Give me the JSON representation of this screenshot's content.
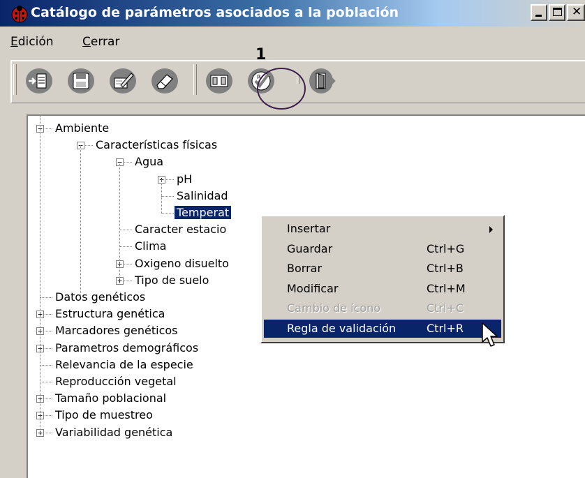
{
  "window": {
    "title": "Catálogo de parámetros asociados a la población",
    "controls": [
      "minimize",
      "maximize",
      "close"
    ]
  },
  "menubar": {
    "items": [
      {
        "accel": "E",
        "rest": "dición"
      },
      {
        "accel": "C",
        "rest": "errar"
      }
    ]
  },
  "toolbar": {
    "buttons": [
      "insert-icon",
      "save-icon",
      "edit-icon",
      "erase-icon",
      "change-icon-icon",
      "validation-rule-icon",
      "exit-icon"
    ]
  },
  "annotation": {
    "number": "1"
  },
  "tree": {
    "nodes": [
      {
        "label": "Ambiente",
        "level": 0,
        "expander": "−"
      },
      {
        "label": "Características físicas",
        "level": 1,
        "expander": "−"
      },
      {
        "label": "Agua",
        "level": 2,
        "expander": "−"
      },
      {
        "label": "pH",
        "level": 3,
        "expander": "+"
      },
      {
        "label": "Salinidad",
        "level": 3,
        "expander": ""
      },
      {
        "label": "Temperat",
        "level": 3,
        "expander": "",
        "selected": true
      },
      {
        "label": "Caracter estacio",
        "level": 2,
        "expander": ""
      },
      {
        "label": "Clima",
        "level": 2,
        "expander": ""
      },
      {
        "label": "Oxigeno disuelto",
        "level": 2,
        "expander": "+"
      },
      {
        "label": "Tipo de suelo",
        "level": 2,
        "expander": "+"
      },
      {
        "label": "Datos genéticos",
        "level": 0,
        "expander": ""
      },
      {
        "label": "Estructura genética",
        "level": 0,
        "expander": "+"
      },
      {
        "label": "Marcadores genéticos",
        "level": 0,
        "expander": "+"
      },
      {
        "label": "Parametros demográficos",
        "level": 0,
        "expander": "+"
      },
      {
        "label": "Relevancia de la especie",
        "level": 0,
        "expander": ""
      },
      {
        "label": "Reproducción vegetal",
        "level": 0,
        "expander": ""
      },
      {
        "label": "Tamaño poblacional",
        "level": 0,
        "expander": "+"
      },
      {
        "label": "Tipo de muestreo",
        "level": 0,
        "expander": "+"
      },
      {
        "label": "Variabilidad genética",
        "level": 0,
        "expander": "+"
      }
    ]
  },
  "context_menu": {
    "items": [
      {
        "label": "Insertar",
        "shortcut": "",
        "submenu": true,
        "disabled": false,
        "active": false
      },
      {
        "label": "Guardar",
        "shortcut": "Ctrl+G",
        "submenu": false,
        "disabled": false,
        "active": false
      },
      {
        "label": "Borrar",
        "shortcut": "Ctrl+B",
        "submenu": false,
        "disabled": false,
        "active": false
      },
      {
        "label": "Modificar",
        "shortcut": "Ctrl+M",
        "submenu": false,
        "disabled": false,
        "active": false
      },
      {
        "label": "Cambio de ícono",
        "shortcut": "Ctrl+C",
        "submenu": false,
        "disabled": true,
        "active": false
      },
      {
        "label": "Regla de validación",
        "shortcut": "Ctrl+R",
        "submenu": false,
        "disabled": false,
        "active": true
      }
    ]
  },
  "colors": {
    "title_start": "#0a246a",
    "selection": "#0a246a",
    "face": "#d4d0c8",
    "annotation_circle": "#3c1f4d"
  }
}
